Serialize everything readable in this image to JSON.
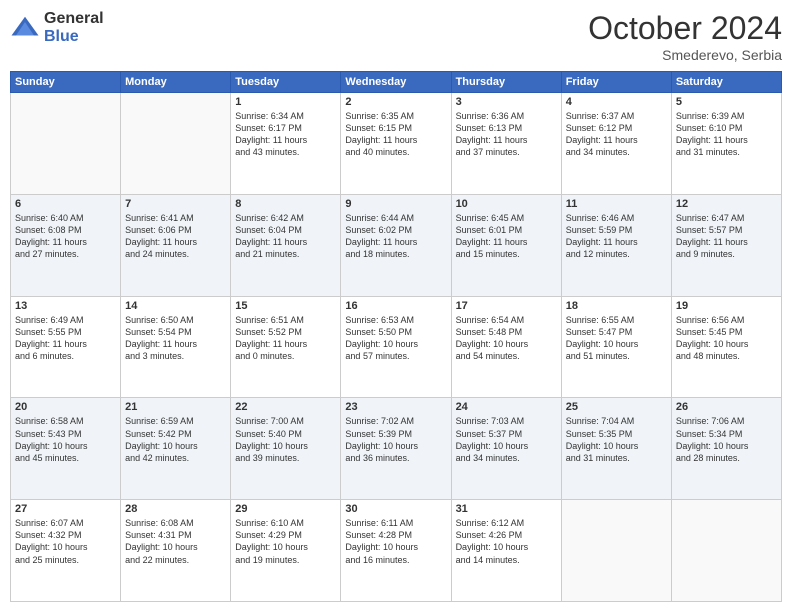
{
  "header": {
    "logo_general": "General",
    "logo_blue": "Blue",
    "month_title": "October 2024",
    "subtitle": "Smederevo, Serbia"
  },
  "weekdays": [
    "Sunday",
    "Monday",
    "Tuesday",
    "Wednesday",
    "Thursday",
    "Friday",
    "Saturday"
  ],
  "weeks": [
    [
      {
        "day": "",
        "info": ""
      },
      {
        "day": "",
        "info": ""
      },
      {
        "day": "1",
        "info": "Sunrise: 6:34 AM\nSunset: 6:17 PM\nDaylight: 11 hours\nand 43 minutes."
      },
      {
        "day": "2",
        "info": "Sunrise: 6:35 AM\nSunset: 6:15 PM\nDaylight: 11 hours\nand 40 minutes."
      },
      {
        "day": "3",
        "info": "Sunrise: 6:36 AM\nSunset: 6:13 PM\nDaylight: 11 hours\nand 37 minutes."
      },
      {
        "day": "4",
        "info": "Sunrise: 6:37 AM\nSunset: 6:12 PM\nDaylight: 11 hours\nand 34 minutes."
      },
      {
        "day": "5",
        "info": "Sunrise: 6:39 AM\nSunset: 6:10 PM\nDaylight: 11 hours\nand 31 minutes."
      }
    ],
    [
      {
        "day": "6",
        "info": "Sunrise: 6:40 AM\nSunset: 6:08 PM\nDaylight: 11 hours\nand 27 minutes."
      },
      {
        "day": "7",
        "info": "Sunrise: 6:41 AM\nSunset: 6:06 PM\nDaylight: 11 hours\nand 24 minutes."
      },
      {
        "day": "8",
        "info": "Sunrise: 6:42 AM\nSunset: 6:04 PM\nDaylight: 11 hours\nand 21 minutes."
      },
      {
        "day": "9",
        "info": "Sunrise: 6:44 AM\nSunset: 6:02 PM\nDaylight: 11 hours\nand 18 minutes."
      },
      {
        "day": "10",
        "info": "Sunrise: 6:45 AM\nSunset: 6:01 PM\nDaylight: 11 hours\nand 15 minutes."
      },
      {
        "day": "11",
        "info": "Sunrise: 6:46 AM\nSunset: 5:59 PM\nDaylight: 11 hours\nand 12 minutes."
      },
      {
        "day": "12",
        "info": "Sunrise: 6:47 AM\nSunset: 5:57 PM\nDaylight: 11 hours\nand 9 minutes."
      }
    ],
    [
      {
        "day": "13",
        "info": "Sunrise: 6:49 AM\nSunset: 5:55 PM\nDaylight: 11 hours\nand 6 minutes."
      },
      {
        "day": "14",
        "info": "Sunrise: 6:50 AM\nSunset: 5:54 PM\nDaylight: 11 hours\nand 3 minutes."
      },
      {
        "day": "15",
        "info": "Sunrise: 6:51 AM\nSunset: 5:52 PM\nDaylight: 11 hours\nand 0 minutes."
      },
      {
        "day": "16",
        "info": "Sunrise: 6:53 AM\nSunset: 5:50 PM\nDaylight: 10 hours\nand 57 minutes."
      },
      {
        "day": "17",
        "info": "Sunrise: 6:54 AM\nSunset: 5:48 PM\nDaylight: 10 hours\nand 54 minutes."
      },
      {
        "day": "18",
        "info": "Sunrise: 6:55 AM\nSunset: 5:47 PM\nDaylight: 10 hours\nand 51 minutes."
      },
      {
        "day": "19",
        "info": "Sunrise: 6:56 AM\nSunset: 5:45 PM\nDaylight: 10 hours\nand 48 minutes."
      }
    ],
    [
      {
        "day": "20",
        "info": "Sunrise: 6:58 AM\nSunset: 5:43 PM\nDaylight: 10 hours\nand 45 minutes."
      },
      {
        "day": "21",
        "info": "Sunrise: 6:59 AM\nSunset: 5:42 PM\nDaylight: 10 hours\nand 42 minutes."
      },
      {
        "day": "22",
        "info": "Sunrise: 7:00 AM\nSunset: 5:40 PM\nDaylight: 10 hours\nand 39 minutes."
      },
      {
        "day": "23",
        "info": "Sunrise: 7:02 AM\nSunset: 5:39 PM\nDaylight: 10 hours\nand 36 minutes."
      },
      {
        "day": "24",
        "info": "Sunrise: 7:03 AM\nSunset: 5:37 PM\nDaylight: 10 hours\nand 34 minutes."
      },
      {
        "day": "25",
        "info": "Sunrise: 7:04 AM\nSunset: 5:35 PM\nDaylight: 10 hours\nand 31 minutes."
      },
      {
        "day": "26",
        "info": "Sunrise: 7:06 AM\nSunset: 5:34 PM\nDaylight: 10 hours\nand 28 minutes."
      }
    ],
    [
      {
        "day": "27",
        "info": "Sunrise: 6:07 AM\nSunset: 4:32 PM\nDaylight: 10 hours\nand 25 minutes."
      },
      {
        "day": "28",
        "info": "Sunrise: 6:08 AM\nSunset: 4:31 PM\nDaylight: 10 hours\nand 22 minutes."
      },
      {
        "day": "29",
        "info": "Sunrise: 6:10 AM\nSunset: 4:29 PM\nDaylight: 10 hours\nand 19 minutes."
      },
      {
        "day": "30",
        "info": "Sunrise: 6:11 AM\nSunset: 4:28 PM\nDaylight: 10 hours\nand 16 minutes."
      },
      {
        "day": "31",
        "info": "Sunrise: 6:12 AM\nSunset: 4:26 PM\nDaylight: 10 hours\nand 14 minutes."
      },
      {
        "day": "",
        "info": ""
      },
      {
        "day": "",
        "info": ""
      }
    ]
  ]
}
